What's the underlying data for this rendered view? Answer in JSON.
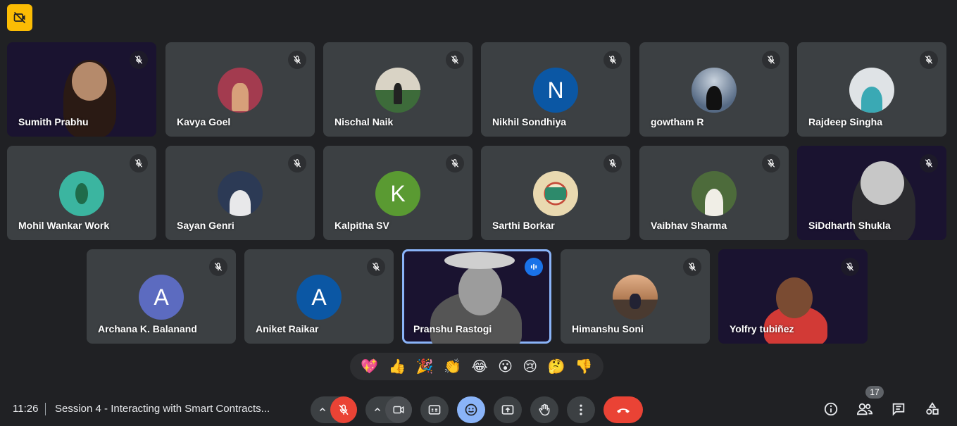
{
  "participants": [
    {
      "name": "Sumith Prabhu",
      "kind": "video"
    },
    {
      "name": "Kavya Goel",
      "kind": "photo",
      "color": "#a33b4f"
    },
    {
      "name": "Nischal Naik",
      "kind": "photo",
      "color": "#3d6b3a"
    },
    {
      "name": "Nikhil Sondhiya",
      "kind": "letter",
      "letter": "N",
      "color": "#0b57a4"
    },
    {
      "name": "gowtham R",
      "kind": "photo",
      "color": "#566a84"
    },
    {
      "name": "Rajdeep Singha",
      "kind": "photo",
      "color": "#3aa9b4"
    },
    {
      "name": "Mohil Wankar Work",
      "kind": "photo",
      "color": "#3bb5a0"
    },
    {
      "name": "Sayan Genri",
      "kind": "photo",
      "color": "#2c3a55"
    },
    {
      "name": "Kalpitha SV",
      "kind": "letter",
      "letter": "K",
      "color": "#5a9a32"
    },
    {
      "name": "Sarthi Borkar",
      "kind": "photo",
      "color": "#e9d9b0"
    },
    {
      "name": "Vaibhav Sharma",
      "kind": "photo",
      "color": "#4d6b3b"
    },
    {
      "name": "SiDdharth Shukla",
      "kind": "video"
    },
    {
      "name": "Archana K. Balanand",
      "kind": "letter",
      "letter": "A",
      "color": "#5c6bc0"
    },
    {
      "name": "Aniket Raikar",
      "kind": "letter",
      "letter": "A",
      "color": "#0b57a4"
    },
    {
      "name": "Pranshu Rastogi",
      "kind": "video-mono",
      "speaking": true
    },
    {
      "name": "Himanshu Soni",
      "kind": "photo",
      "color": "#b07a52"
    },
    {
      "name": "Yolfry tubiñez",
      "kind": "video"
    }
  ],
  "reactions": [
    "💖",
    "👍",
    "🎉",
    "👏",
    "😂",
    "😮",
    "😢",
    "🤔",
    "👎"
  ],
  "footer": {
    "time": "11:26",
    "meeting_title": "Session 4 - Interacting with Smart Contracts...",
    "participant_count": "17"
  },
  "colors": {
    "background": "#202124",
    "tile": "#3c4043",
    "leave_red": "#ea4335",
    "accent_blue": "#8ab4f8",
    "badge_yellow": "#fbbc04"
  }
}
